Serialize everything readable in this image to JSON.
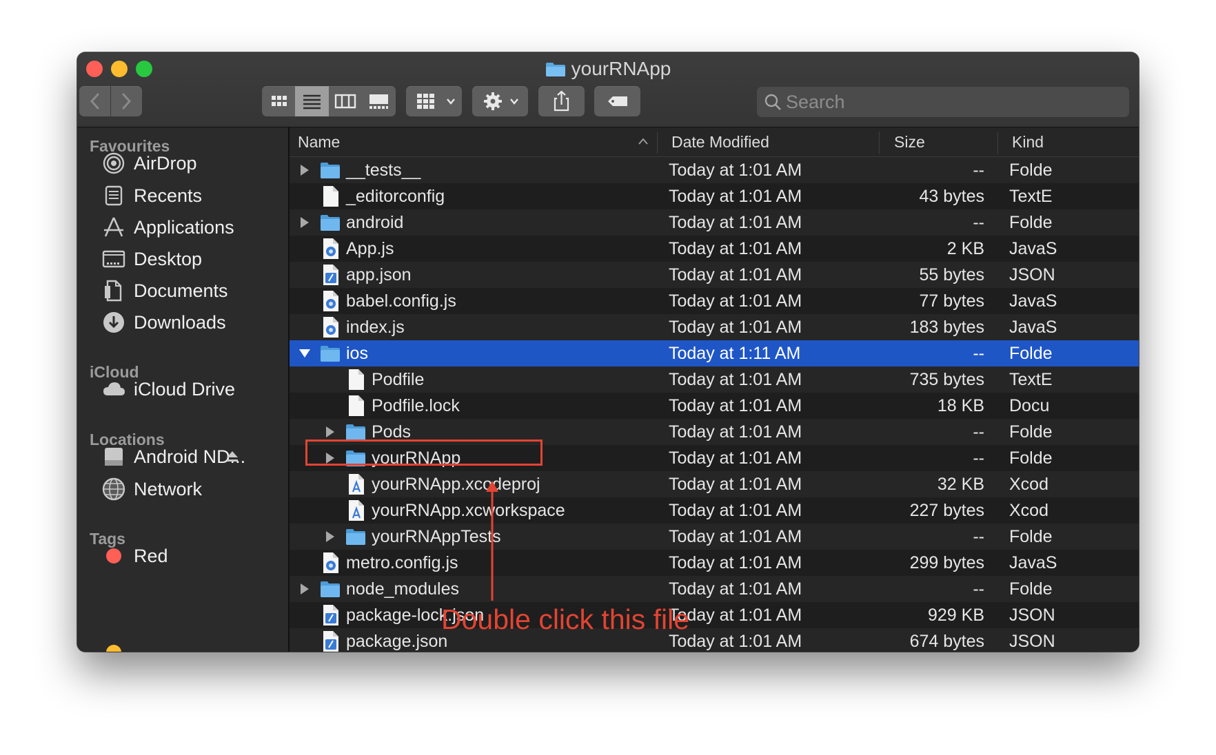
{
  "window": {
    "title": "yourRNApp"
  },
  "toolbar": {
    "search_placeholder": "Search",
    "traffic_light_colors": {
      "close": "#fe5f57",
      "minimize": "#febc2e",
      "zoom": "#28c840"
    }
  },
  "sidebar": {
    "favourites_label": "Favourites",
    "favourites": [
      {
        "label": "AirDrop",
        "icon": "airdrop-icon"
      },
      {
        "label": "Recents",
        "icon": "recents-icon"
      },
      {
        "label": "Applications",
        "icon": "applications-icon"
      },
      {
        "label": "Desktop",
        "icon": "desktop-icon"
      },
      {
        "label": "Documents",
        "icon": "documents-icon"
      },
      {
        "label": "Downloads",
        "icon": "downloads-icon"
      }
    ],
    "icloud_label": "iCloud",
    "icloud": [
      {
        "label": "iCloud Drive",
        "icon": "icloud-icon"
      }
    ],
    "locations_label": "Locations",
    "locations": [
      {
        "label": "Android ND...",
        "icon": "disk-icon"
      },
      {
        "label": "Network",
        "icon": "network-icon"
      }
    ],
    "tags_label": "Tags",
    "tags": [
      {
        "label": "Red",
        "color": "#fe5f57"
      }
    ]
  },
  "columns": {
    "name": "Name",
    "date": "Date Modified",
    "size": "Size",
    "kind": "Kind"
  },
  "files": [
    {
      "name": "__tests__",
      "date": "Today at 1:01 AM",
      "size": "--",
      "kind": "Folde",
      "type": "folder",
      "level": 0,
      "disclosure": "closed"
    },
    {
      "name": "_editorconfig",
      "date": "Today at 1:01 AM",
      "size": "43 bytes",
      "kind": "TextE",
      "type": "doc",
      "level": 0,
      "disclosure": "none"
    },
    {
      "name": "android",
      "date": "Today at 1:01 AM",
      "size": "--",
      "kind": "Folde",
      "type": "folder",
      "level": 0,
      "disclosure": "closed"
    },
    {
      "name": "App.js",
      "date": "Today at 1:01 AM",
      "size": "2 KB",
      "kind": "JavaS",
      "type": "js",
      "level": 0,
      "disclosure": "none"
    },
    {
      "name": "app.json",
      "date": "Today at 1:01 AM",
      "size": "55 bytes",
      "kind": "JSON",
      "type": "json",
      "level": 0,
      "disclosure": "none"
    },
    {
      "name": "babel.config.js",
      "date": "Today at 1:01 AM",
      "size": "77 bytes",
      "kind": "JavaS",
      "type": "js",
      "level": 0,
      "disclosure": "none"
    },
    {
      "name": "index.js",
      "date": "Today at 1:01 AM",
      "size": "183 bytes",
      "kind": "JavaS",
      "type": "js",
      "level": 0,
      "disclosure": "none"
    },
    {
      "name": "ios",
      "date": "Today at 1:11 AM",
      "size": "--",
      "kind": "Folde",
      "type": "folder",
      "level": 0,
      "disclosure": "open",
      "selected": true
    },
    {
      "name": "Podfile",
      "date": "Today at 1:01 AM",
      "size": "735 bytes",
      "kind": "TextE",
      "type": "doc",
      "level": 1,
      "disclosure": "none"
    },
    {
      "name": "Podfile.lock",
      "date": "Today at 1:01 AM",
      "size": "18 KB",
      "kind": "Docu",
      "type": "doc",
      "level": 1,
      "disclosure": "none"
    },
    {
      "name": "Pods",
      "date": "Today at 1:01 AM",
      "size": "--",
      "kind": "Folde",
      "type": "folder",
      "level": 1,
      "disclosure": "closed"
    },
    {
      "name": "yourRNApp",
      "date": "Today at 1:01 AM",
      "size": "--",
      "kind": "Folde",
      "type": "folder",
      "level": 1,
      "disclosure": "closed"
    },
    {
      "name": "yourRNApp.xcodeproj",
      "date": "Today at 1:01 AM",
      "size": "32 KB",
      "kind": "Xcod",
      "type": "xcode",
      "level": 1,
      "disclosure": "none"
    },
    {
      "name": "yourRNApp.xcworkspace",
      "date": "Today at 1:01 AM",
      "size": "227 bytes",
      "kind": "Xcod",
      "type": "xcode",
      "level": 1,
      "disclosure": "none"
    },
    {
      "name": "yourRNAppTests",
      "date": "Today at 1:01 AM",
      "size": "--",
      "kind": "Folde",
      "type": "folder",
      "level": 1,
      "disclosure": "closed"
    },
    {
      "name": "metro.config.js",
      "date": "Today at 1:01 AM",
      "size": "299 bytes",
      "kind": "JavaS",
      "type": "js",
      "level": 0,
      "disclosure": "none"
    },
    {
      "name": "node_modules",
      "date": "Today at 1:01 AM",
      "size": "--",
      "kind": "Folde",
      "type": "folder",
      "level": 0,
      "disclosure": "closed"
    },
    {
      "name": "package-lock.json",
      "date": "Today at 1:01 AM",
      "size": "929 KB",
      "kind": "JSON",
      "type": "json",
      "level": 0,
      "disclosure": "none"
    },
    {
      "name": "package.json",
      "date": "Today at 1:01 AM",
      "size": "674 bytes",
      "kind": "JSON",
      "type": "json",
      "level": 0,
      "disclosure": "none"
    }
  ],
  "annotation": {
    "text": "Double click this file",
    "color": "#e34432"
  }
}
